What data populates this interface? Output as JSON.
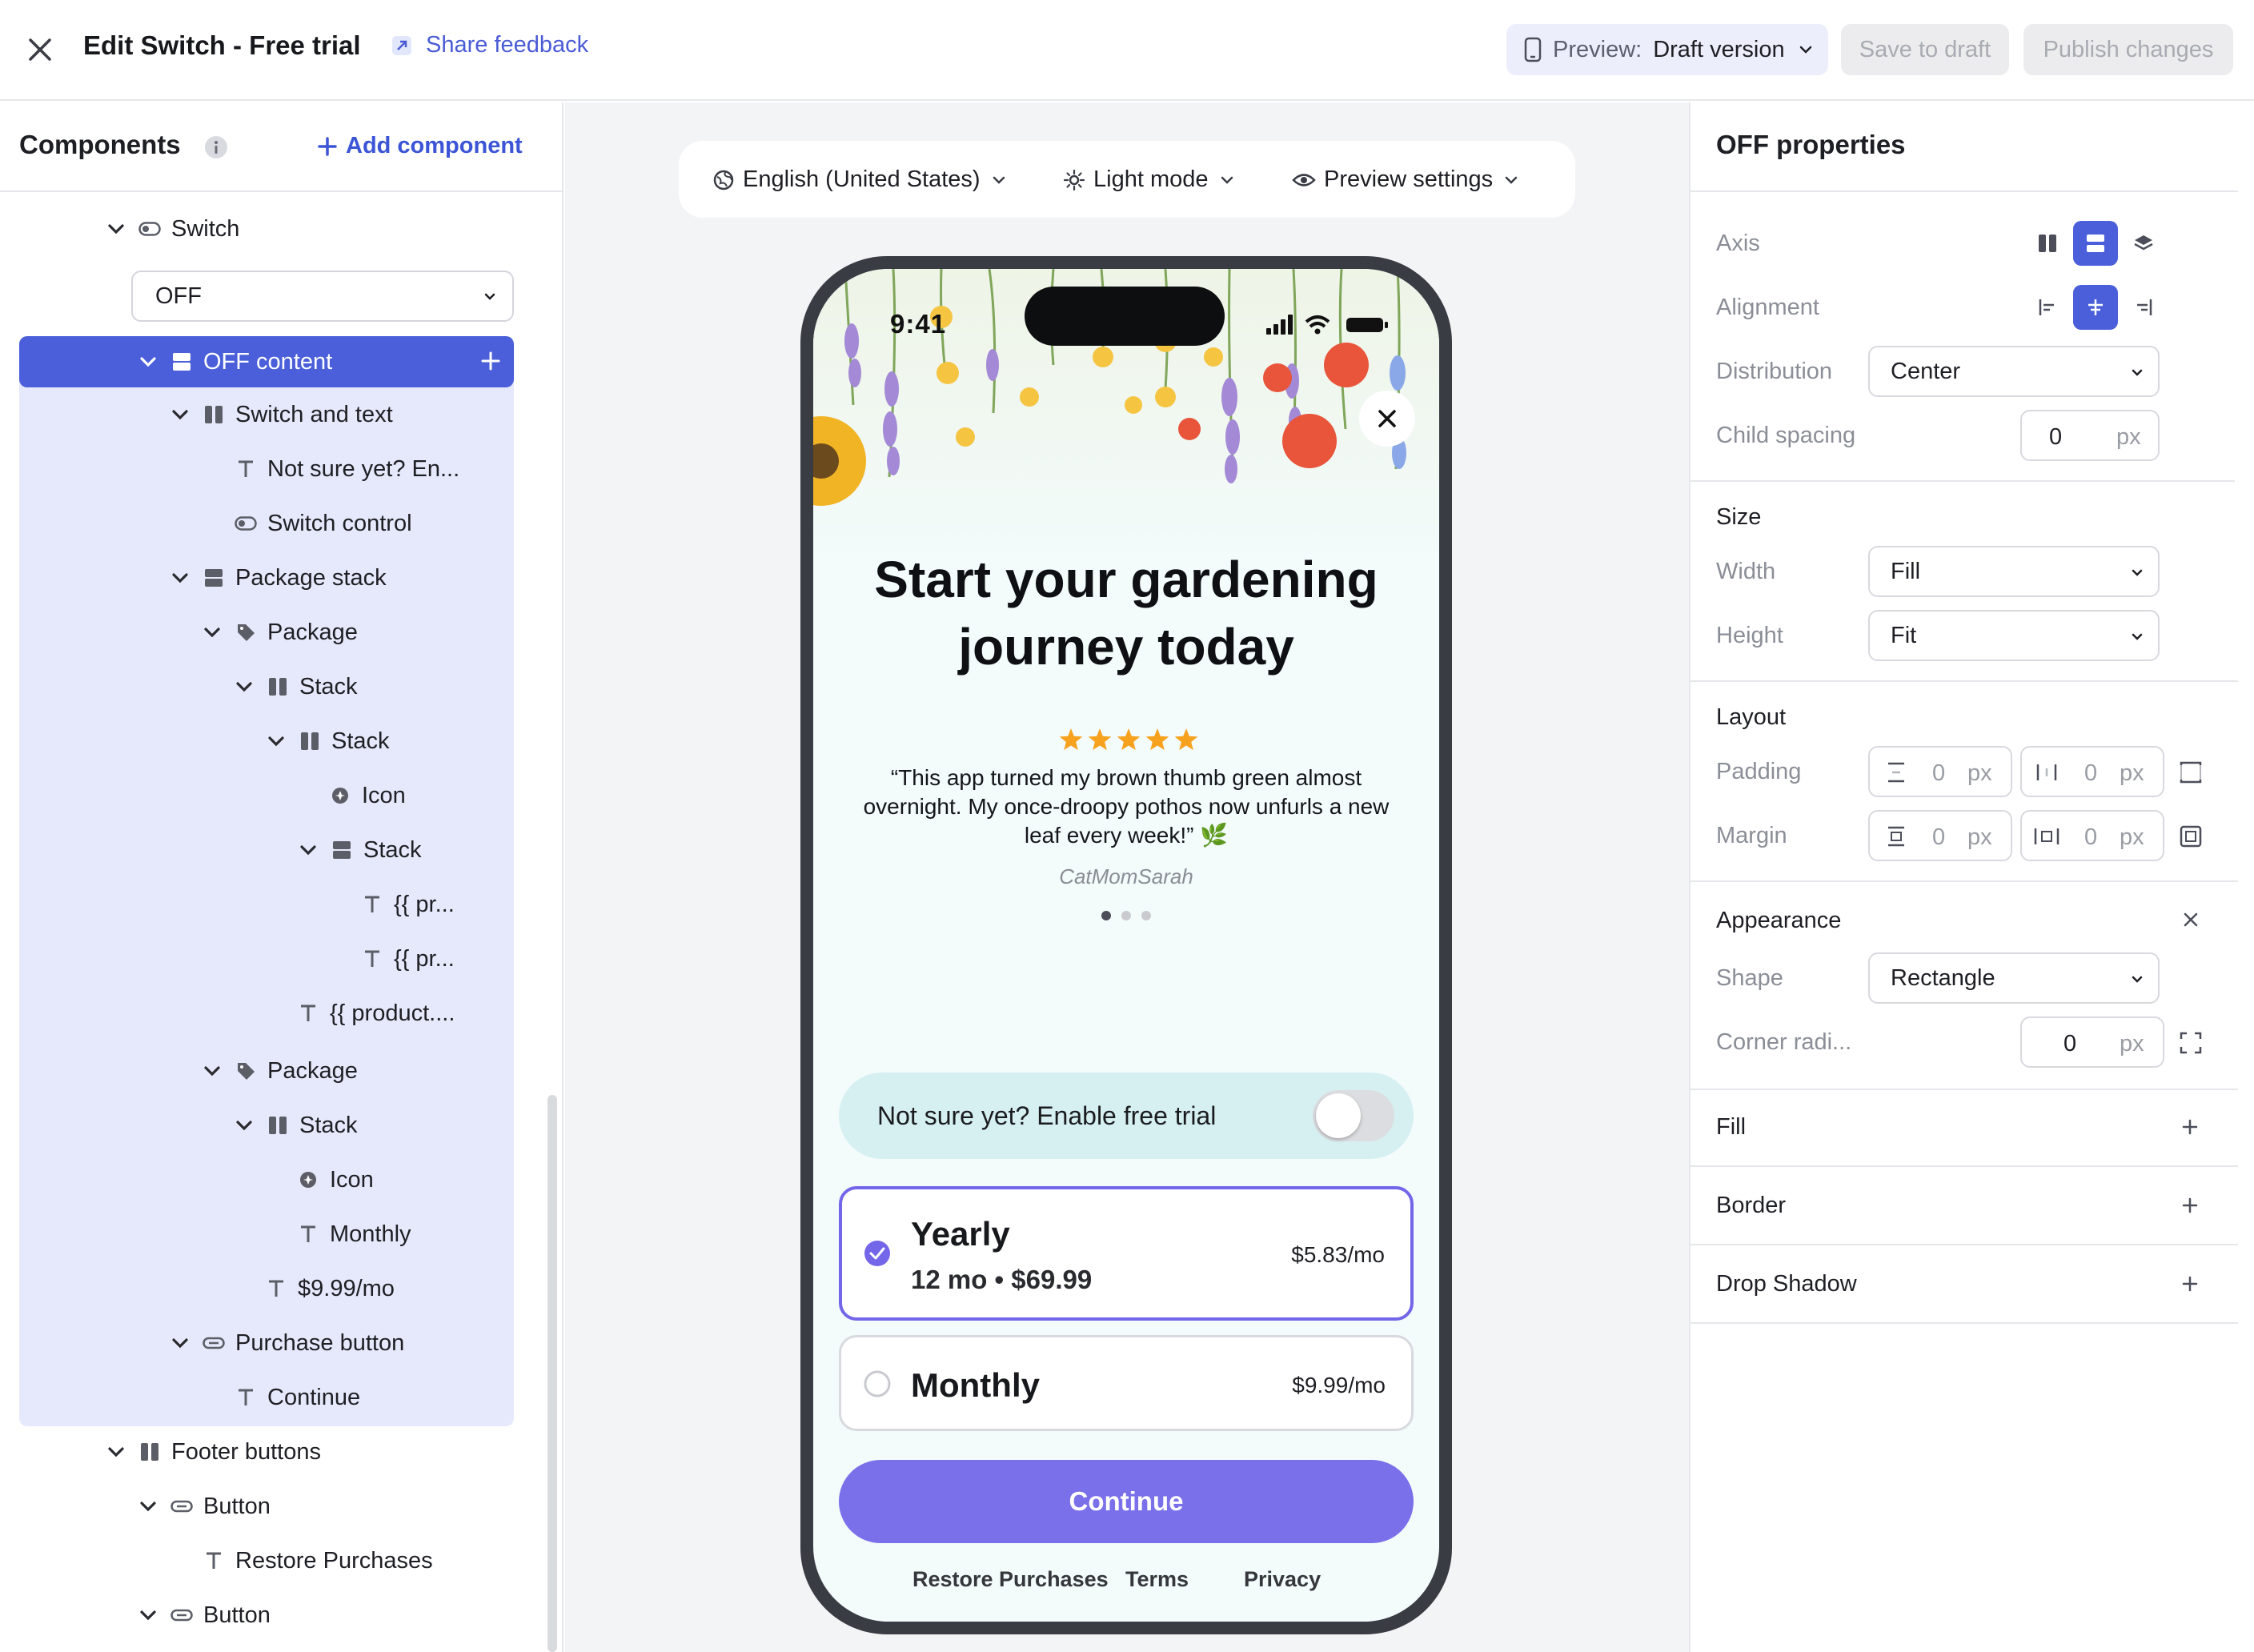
{
  "header": {
    "title": "Edit Switch - Free trial",
    "share_feedback": "Share feedback",
    "preview_prefix": "Preview:",
    "preview_value": "Draft version",
    "save_to_draft": "Save to draft",
    "publish_changes": "Publish changes"
  },
  "components_panel": {
    "title": "Components",
    "add_component": "Add component",
    "switch_state": "OFF",
    "tree": {
      "switch": "Switch",
      "off_content": "OFF content",
      "switch_and_text": "Switch and text",
      "not_sure_text": "Not sure yet? En...",
      "switch_control": "Switch control",
      "package_stack": "Package stack",
      "package1": "Package",
      "stack1": "Stack",
      "stack2": "Stack",
      "icon1": "Icon",
      "stack3": "Stack",
      "pr1": "{{ pr...",
      "pr2": "{{ pr...",
      "product": "{{ product....",
      "package2": "Package",
      "stack4": "Stack",
      "icon2": "Icon",
      "monthly": "Monthly",
      "monthly_price": "$9.99/mo",
      "purchase_button": "Purchase button",
      "continue": "Continue",
      "footer_buttons": "Footer buttons",
      "button1": "Button",
      "restore_purchases": "Restore Purchases",
      "button2": "Button"
    }
  },
  "preview_toolbar": {
    "language": "English (United States)",
    "mode": "Light mode",
    "settings": "Preview settings"
  },
  "phone": {
    "time": "9:41",
    "headline": "Start your gardening journey today",
    "rating": 5,
    "quote": "“This app turned my brown thumb green almost overnight. My once-droopy pothos now unfurls a new leaf every week!” 🌿",
    "author": "CatMomSarah",
    "carousel_pages": 3,
    "carousel_active": 1,
    "trial_label": "Not sure yet? Enable free trial",
    "trial_enabled": false,
    "packages": [
      {
        "name": "Yearly",
        "subtitle": "12 mo • $69.99",
        "price": "$5.83/mo",
        "selected": true
      },
      {
        "name": "Monthly",
        "price": "$9.99/mo",
        "selected": false
      }
    ],
    "continue": "Continue",
    "footer": [
      "Restore Purchases",
      "Terms",
      "Privacy"
    ]
  },
  "properties": {
    "title": "OFF properties",
    "axis_label": "Axis",
    "alignment_label": "Alignment",
    "distribution_label": "Distribution",
    "distribution_value": "Center",
    "child_spacing_label": "Child spacing",
    "child_spacing_value": "0",
    "unit": "px",
    "size_title": "Size",
    "width_label": "Width",
    "width_value": "Fill",
    "height_label": "Height",
    "height_value": "Fit",
    "layout_title": "Layout",
    "padding_label": "Padding",
    "padding_v": "0",
    "padding_h": "0",
    "margin_label": "Margin",
    "margin_v": "0",
    "margin_h": "0",
    "appearance_title": "Appearance",
    "shape_label": "Shape",
    "shape_value": "Rectangle",
    "corner_label": "Corner radi...",
    "corner_value": "0",
    "fill_title": "Fill",
    "border_title": "Border",
    "shadow_title": "Drop Shadow"
  },
  "colors": {
    "accent": "#4a5fd9",
    "cta": "#7a70ea",
    "selected_border": "#7466e8",
    "trial_bg": "#d6f0f2"
  }
}
